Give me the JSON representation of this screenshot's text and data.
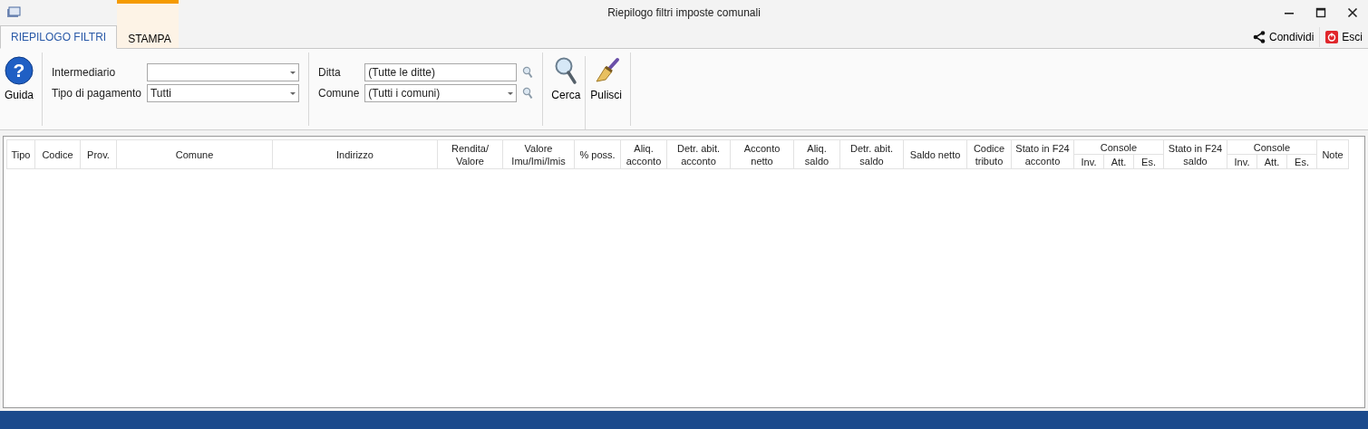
{
  "window": {
    "title": "Riepilogo filtri imposte comunali"
  },
  "tabs": [
    {
      "label": "RIEPILOGO FILTRI",
      "selected": true
    },
    {
      "label": "STAMPA",
      "selected": false
    }
  ],
  "header_actions": [
    {
      "kind": "share",
      "label": "Condividi"
    },
    {
      "kind": "exit",
      "label": "Esci"
    }
  ],
  "ribbon": {
    "help_icon": "?",
    "help": "Guida",
    "filters_left": [
      {
        "label": "Intermediario"
      },
      {
        "label": "Tipo di pagamento",
        "value": "Tutti"
      }
    ],
    "filters_right": [
      {
        "label": "Ditta",
        "value": "(Tutte le ditte)",
        "dropdown": false
      },
      {
        "label": "Comune",
        "value": "(Tutti i comuni)",
        "dropdown": true
      }
    ],
    "search": "Cerca",
    "clear": "Pulisci"
  },
  "table": {
    "columns": [
      {
        "label": "Tipo"
      },
      {
        "label": "Codice"
      },
      {
        "label": "Prov."
      },
      {
        "label": "Comune"
      },
      {
        "label": "Indirizzo"
      },
      {
        "label": "Rendita/ Valore"
      },
      {
        "label": "Valore Imu/Imi/Imis"
      },
      {
        "label": "% poss."
      },
      {
        "label": "Aliq. acconto"
      },
      {
        "label": "Detr. abit. acconto"
      },
      {
        "label": "Acconto netto"
      },
      {
        "label": "Aliq. saldo"
      },
      {
        "label": "Detr. abit. saldo"
      },
      {
        "label": "Saldo netto"
      },
      {
        "label": "Codice tributo"
      },
      {
        "label": "Stato in F24 acconto"
      },
      {
        "label": "Console",
        "children": [
          "Inv.",
          "Att.",
          "Es."
        ]
      },
      {
        "label": "Stato in F24 saldo"
      },
      {
        "label": "Console",
        "children": [
          "Inv.",
          "Att.",
          "Es."
        ]
      },
      {
        "label": "Note"
      }
    ]
  }
}
